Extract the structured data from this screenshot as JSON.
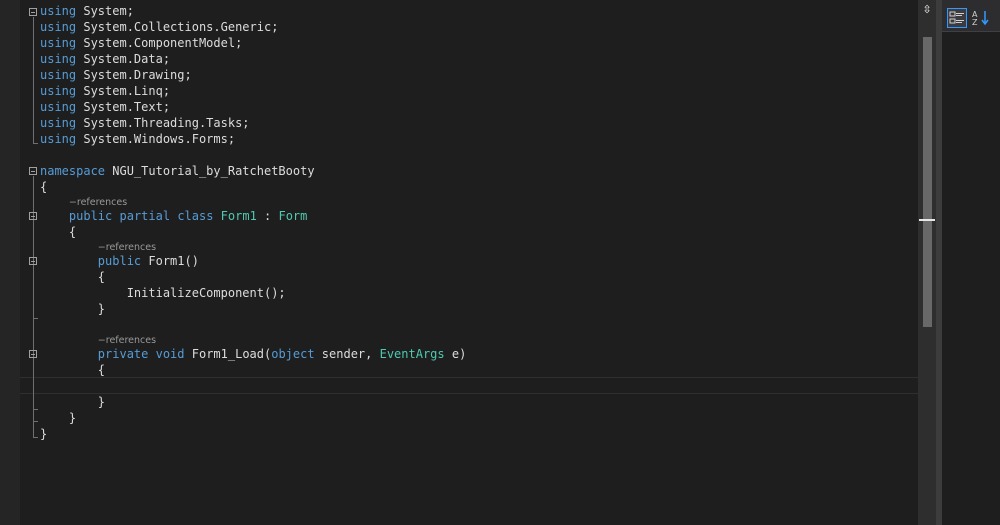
{
  "code": {
    "lines": [
      [
        {
          "t": "using",
          "c": "#569cd6"
        },
        {
          "t": " System;",
          "c": "#dcdcdc"
        }
      ],
      [
        {
          "t": "using",
          "c": "#569cd6"
        },
        {
          "t": " System.Collections.Generic;",
          "c": "#dcdcdc"
        }
      ],
      [
        {
          "t": "using",
          "c": "#569cd6"
        },
        {
          "t": " System.ComponentModel;",
          "c": "#dcdcdc"
        }
      ],
      [
        {
          "t": "using",
          "c": "#569cd6"
        },
        {
          "t": " System.Data;",
          "c": "#dcdcdc"
        }
      ],
      [
        {
          "t": "using",
          "c": "#569cd6"
        },
        {
          "t": " System.Drawing;",
          "c": "#dcdcdc"
        }
      ],
      [
        {
          "t": "using",
          "c": "#569cd6"
        },
        {
          "t": " System.Linq;",
          "c": "#dcdcdc"
        }
      ],
      [
        {
          "t": "using",
          "c": "#569cd6"
        },
        {
          "t": " System.Text;",
          "c": "#dcdcdc"
        }
      ],
      [
        {
          "t": "using",
          "c": "#569cd6"
        },
        {
          "t": " System.Threading.Tasks;",
          "c": "#dcdcdc"
        }
      ],
      [
        {
          "t": "using",
          "c": "#569cd6"
        },
        {
          "t": " System.Windows.Forms;",
          "c": "#dcdcdc"
        }
      ],
      [],
      [
        {
          "t": "namespace",
          "c": "#569cd6"
        },
        {
          "t": " NGU_Tutorial_by_RatchetBooty",
          "c": "#dcdcdc"
        }
      ],
      [
        {
          "t": "{",
          "c": "#dcdcdc"
        }
      ],
      [
        {
          "t": "    ",
          "c": "#dcdcdc"
        },
        {
          "t": "public",
          "c": "#569cd6"
        },
        {
          "t": " ",
          "c": "#dcdcdc"
        },
        {
          "t": "partial",
          "c": "#569cd6"
        },
        {
          "t": " ",
          "c": "#dcdcdc"
        },
        {
          "t": "class",
          "c": "#569cd6"
        },
        {
          "t": " ",
          "c": "#dcdcdc"
        },
        {
          "t": "Form1",
          "c": "#4ec9b0"
        },
        {
          "t": " : ",
          "c": "#dcdcdc"
        },
        {
          "t": "Form",
          "c": "#4ec9b0"
        }
      ],
      [
        {
          "t": "    {",
          "c": "#dcdcdc"
        }
      ],
      [
        {
          "t": "        ",
          "c": "#dcdcdc"
        },
        {
          "t": "public",
          "c": "#569cd6"
        },
        {
          "t": " Form1()",
          "c": "#dcdcdc"
        }
      ],
      [
        {
          "t": "        {",
          "c": "#dcdcdc"
        }
      ],
      [
        {
          "t": "            InitializeComponent();",
          "c": "#dcdcdc"
        }
      ],
      [
        {
          "t": "        }",
          "c": "#dcdcdc"
        }
      ],
      [],
      [
        {
          "t": "        ",
          "c": "#dcdcdc"
        },
        {
          "t": "private",
          "c": "#569cd6"
        },
        {
          "t": " ",
          "c": "#dcdcdc"
        },
        {
          "t": "void",
          "c": "#569cd6"
        },
        {
          "t": " Form1_Load(",
          "c": "#dcdcdc"
        },
        {
          "t": "object",
          "c": "#569cd6"
        },
        {
          "t": " sender, ",
          "c": "#dcdcdc"
        },
        {
          "t": "EventArgs",
          "c": "#4ec9b0"
        },
        {
          "t": " e)",
          "c": "#dcdcdc"
        }
      ],
      [
        {
          "t": "        {",
          "c": "#dcdcdc"
        }
      ],
      [],
      [
        {
          "t": "        }",
          "c": "#dcdcdc"
        }
      ],
      [
        {
          "t": "    }",
          "c": "#dcdcdc"
        }
      ],
      [
        {
          "t": "}",
          "c": "#dcdcdc"
        }
      ]
    ],
    "ref_label": "−references",
    "ref_indents": [
      "    ",
      "        ",
      "        "
    ]
  },
  "icons": {
    "split": "split-editor-icon",
    "categorized": "categorized-view-icon",
    "alphabetical": "sort-alphabetical-icon"
  }
}
